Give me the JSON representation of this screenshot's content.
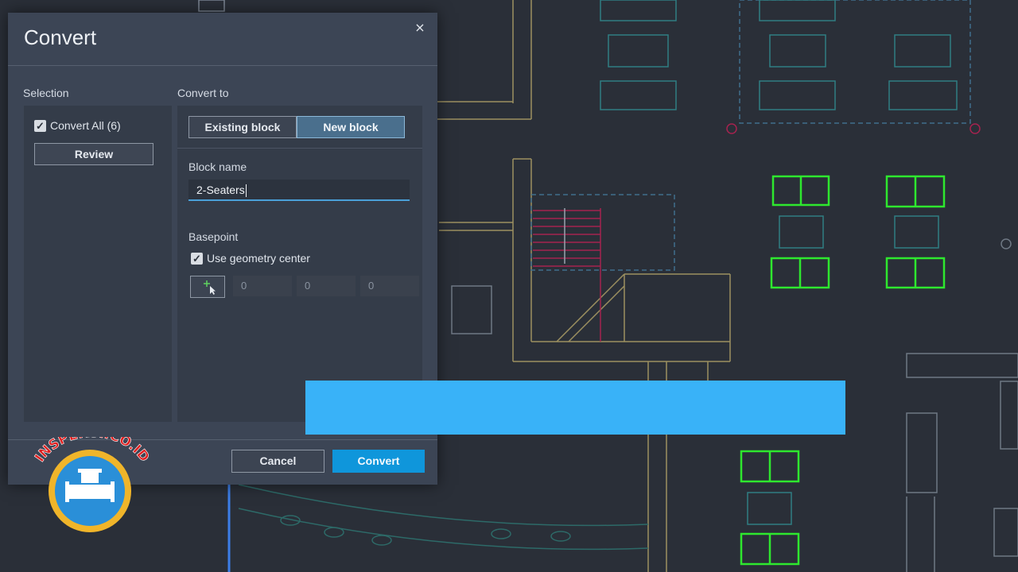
{
  "dialog": {
    "title": "Convert",
    "close_glyph": "×",
    "selection": {
      "label": "Selection",
      "convert_all_label": "Convert All (6)",
      "convert_all_checked": true,
      "review_label": "Review"
    },
    "convert_to": {
      "label": "Convert to",
      "existing_block_label": "Existing block",
      "new_block_label": "New block",
      "active_option": "New block"
    },
    "block_name": {
      "label": "Block name",
      "value": "2-Seaters"
    },
    "basepoint": {
      "label": "Basepoint",
      "use_geometry_center_label": "Use geometry center",
      "use_geometry_center_checked": true,
      "pick_icon": "pick-point-icon",
      "x": "0",
      "y": "0",
      "z": "0"
    },
    "footer": {
      "cancel_label": "Cancel",
      "convert_label": "Convert"
    }
  },
  "logo": {
    "text": "INSPEKSI.CO.ID"
  },
  "colors": {
    "accent": "#0f96db",
    "banner": "#39b2f8",
    "cad_green": "#2ee82e",
    "dialog_bg": "#3c4555"
  }
}
